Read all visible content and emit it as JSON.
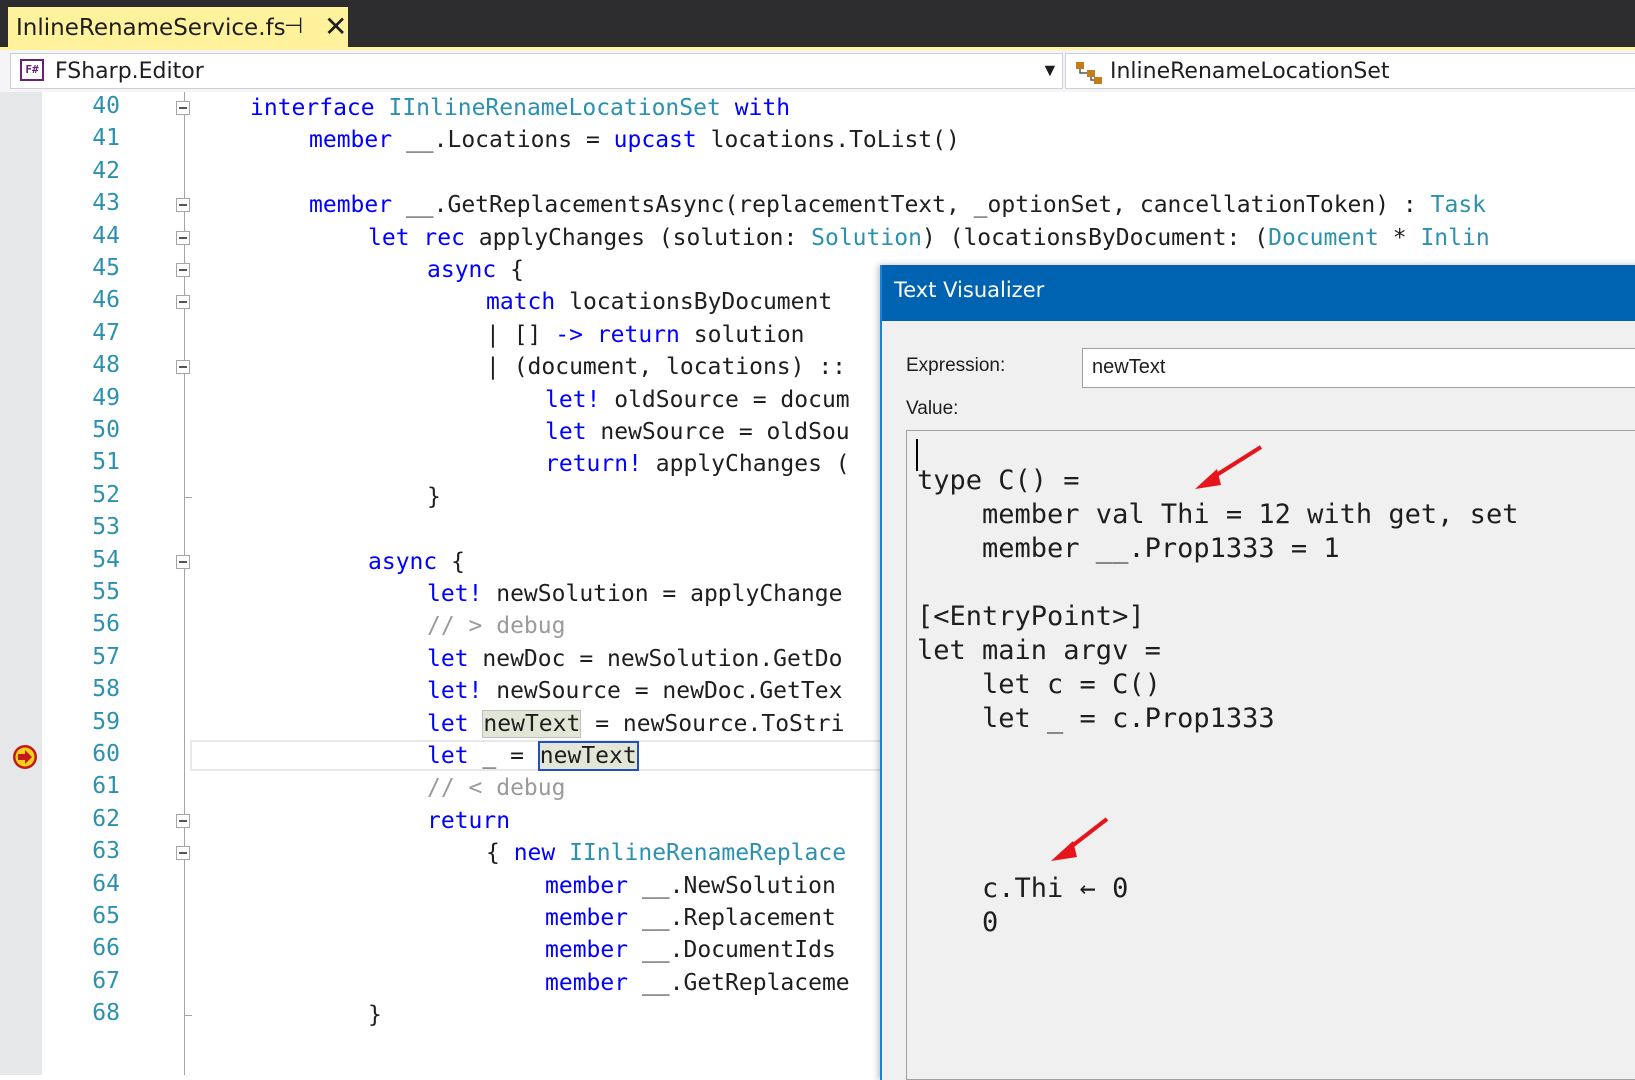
{
  "tab": {
    "title": "InlineRenameService.fs",
    "pin_glyph": "⊣",
    "close_glyph": "✕"
  },
  "navbar": {
    "project_icon_text": "F#",
    "project": "FSharp.Editor",
    "type": "InlineRenameLocationSet"
  },
  "editor": {
    "lines": [
      {
        "n": "40"
      },
      {
        "n": "41"
      },
      {
        "n": "42"
      },
      {
        "n": "43"
      },
      {
        "n": "44"
      },
      {
        "n": "45"
      },
      {
        "n": "46"
      },
      {
        "n": "47"
      },
      {
        "n": "48"
      },
      {
        "n": "49"
      },
      {
        "n": "50"
      },
      {
        "n": "51"
      },
      {
        "n": "52"
      },
      {
        "n": "53"
      },
      {
        "n": "54"
      },
      {
        "n": "55"
      },
      {
        "n": "56"
      },
      {
        "n": "57"
      },
      {
        "n": "58"
      },
      {
        "n": "59"
      },
      {
        "n": "60"
      },
      {
        "n": "61"
      },
      {
        "n": "62"
      },
      {
        "n": "63"
      },
      {
        "n": "64"
      },
      {
        "n": "65"
      },
      {
        "n": "66"
      },
      {
        "n": "67"
      },
      {
        "n": "68"
      }
    ],
    "code": {
      "l40": [
        "interface",
        "IInlineRenameLocationSet",
        "with"
      ],
      "l41": [
        "member",
        " __.Locations = ",
        "upcast",
        " locations.ToList()"
      ],
      "l43": [
        "member",
        " __.GetReplacementsAsync(replacementText, _optionSet, cancellationToken) : ",
        "Task"
      ],
      "l44": [
        "let",
        "rec",
        " applyChanges (solution: ",
        "Solution",
        ") (locationsByDocument: (",
        "Document",
        " * ",
        "Inlin"
      ],
      "l45": [
        "async",
        " {"
      ],
      "l46": [
        "match",
        " locationsByDocument"
      ],
      "l47": [
        "| [] ",
        "->",
        "return",
        " solution"
      ],
      "l48": [
        "| (document, locations) ::"
      ],
      "l49": [
        "let!",
        " oldSource = docum"
      ],
      "l50": [
        "let",
        " newSource = oldSou"
      ],
      "l51": [
        "return!",
        " applyChanges ("
      ],
      "l52": [
        "}"
      ],
      "l54": [
        "async",
        " {"
      ],
      "l55": [
        "let!",
        " newSolution = applyChange"
      ],
      "l56": [
        "// > debug"
      ],
      "l57": [
        "let",
        " newDoc = newSolution.GetDo"
      ],
      "l58": [
        "let!",
        " newSource = newDoc.GetTex"
      ],
      "l59": [
        "let",
        "newText",
        " = newSource.ToStri"
      ],
      "l60": [
        "let",
        " _ = ",
        "newText"
      ],
      "l61": [
        "// < debug"
      ],
      "l62": [
        "return"
      ],
      "l63": [
        "{ ",
        "new",
        "IInlineRenameReplace"
      ],
      "l64": [
        "member",
        " __.NewSolution"
      ],
      "l65": [
        "member",
        " __.Replacement"
      ],
      "l66": [
        "member",
        " __.DocumentIds"
      ],
      "l67": [
        "member",
        " __.GetReplaceme"
      ],
      "l68": [
        "}"
      ]
    }
  },
  "visualizer": {
    "title": "Text Visualizer",
    "expression_label": "Expression:",
    "expression_value": "newText",
    "value_label": "Value:",
    "value_lines": [
      "type C() =",
      "    member val Thi = 12 with get, set",
      "    member __.Prop1333 = 1",
      "",
      "[<EntryPoint>]",
      "let main argv =",
      "    let c = C()",
      "    let _ = c.Prop1333",
      "",
      "",
      "",
      "",
      "    c.Thi ← 0",
      "    0"
    ]
  },
  "colors": {
    "keyword": "#0000ff",
    "type": "#2b91af",
    "comment": "#9b9b9b",
    "linenum": "#2b91af",
    "dialog_title": "#0063b1",
    "tab_active": "#fff29d",
    "annotation_arrow": "#e8141b"
  }
}
